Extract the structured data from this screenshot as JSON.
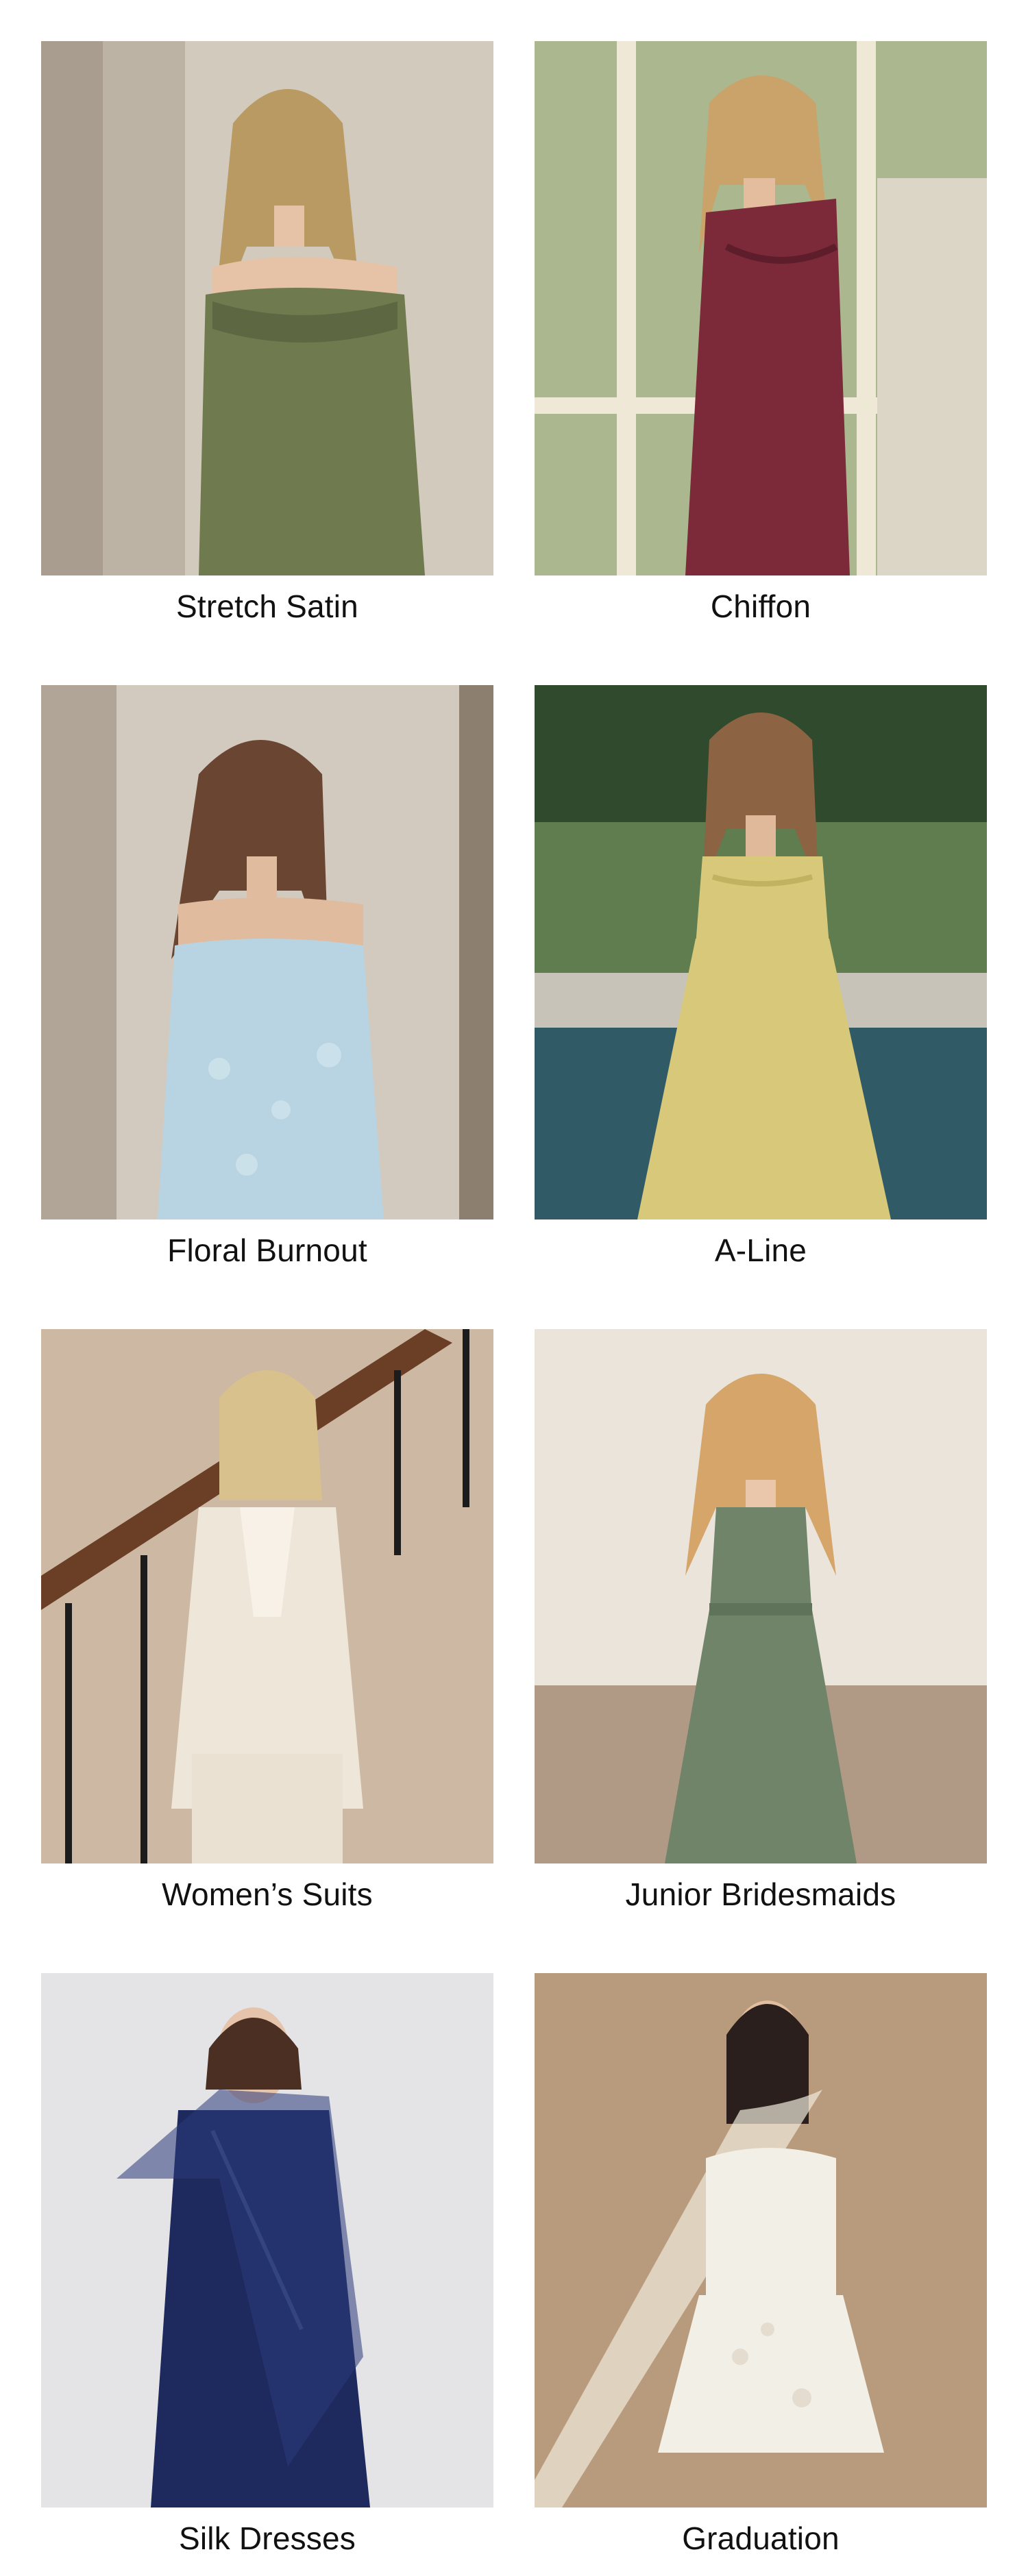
{
  "categories": [
    {
      "label": "Stretch Satin",
      "image": "woman in olive off-shoulder satin dress",
      "dress_color": "#6f7a4f",
      "bg_color": "#cfc6b7"
    },
    {
      "label": "Chiffon",
      "image": "woman in burgundy one-shoulder dress by window",
      "dress_color": "#7c2a3a",
      "bg_color": "#d9d2bf"
    },
    {
      "label": "Floral Burnout",
      "image": "woman in light blue corset floral dress",
      "dress_color": "#b8d4e2",
      "bg_color": "#cdc5ba"
    },
    {
      "label": "A-Line",
      "image": "woman in yellow a-line dress by pool",
      "dress_color": "#d7c979",
      "bg_color": "#3f5a3a"
    },
    {
      "label": "Women’s Suits",
      "image": "woman in ivory suit on staircase",
      "dress_color": "#efe6da",
      "bg_color": "#cdb9a3"
    },
    {
      "label": "Junior Bridesmaids",
      "image": "girl in sage green sleeveless dress",
      "dress_color": "#6f8468",
      "bg_color": "#eae4db"
    },
    {
      "label": "Silk Dresses",
      "image": "woman in navy silk dress with sheer scarf",
      "dress_color": "#1e2a5e",
      "bg_color": "#e4e4e6"
    },
    {
      "label": "Graduation",
      "image": "woman in white strapless mini dress",
      "dress_color": "#f2efe6",
      "bg_color": "#b89a7c"
    }
  ]
}
